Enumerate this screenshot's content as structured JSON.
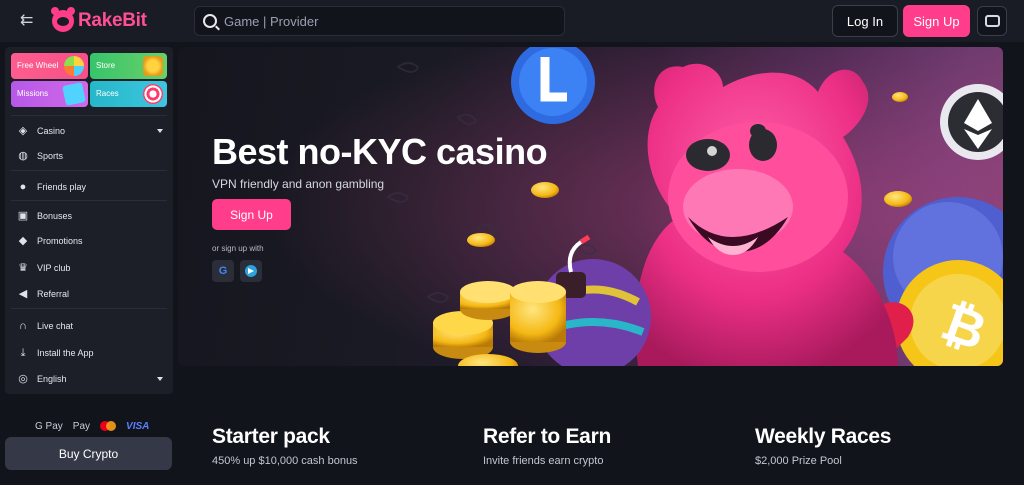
{
  "header": {
    "logo_text": "RakeBit",
    "search_placeholder": "Game | Provider",
    "login_label": "Log In",
    "signup_label": "Sign Up"
  },
  "sidebar": {
    "promos": [
      {
        "label": "Free Wheel"
      },
      {
        "label": "Store"
      },
      {
        "label": "Missions"
      },
      {
        "label": "Races"
      }
    ],
    "items": [
      {
        "label": "Casino",
        "icon": "cube-icon"
      },
      {
        "label": "Sports",
        "icon": "basketball-icon"
      },
      {
        "label": "Friends play",
        "icon": "user-icon"
      },
      {
        "label": "Bonuses",
        "icon": "gift-icon"
      },
      {
        "label": "Promotions",
        "icon": "tag-icon"
      },
      {
        "label": "VIP club",
        "icon": "crown-icon"
      },
      {
        "label": "Referral",
        "icon": "megaphone-icon"
      },
      {
        "label": "Live chat",
        "icon": "headphones-icon"
      },
      {
        "label": "Install the App",
        "icon": "download-icon"
      },
      {
        "label": "English",
        "icon": "globe-icon"
      }
    ]
  },
  "payments": {
    "gpay": "G Pay",
    "applepay": "Pay",
    "visa": "VISA",
    "buy_crypto_label": "Buy Crypto"
  },
  "hero": {
    "title": "Best no-KYC casino",
    "subtitle": "VPN friendly and anon gambling",
    "signup_label": "Sign Up",
    "or_text": "or sign up with",
    "google_glyph": "G"
  },
  "features": [
    {
      "title": "Starter pack",
      "desc": "450% up $10,000 cash bonus"
    },
    {
      "title": "Refer to Earn",
      "desc": "Invite friends earn crypto"
    },
    {
      "title": "Weekly Races",
      "desc": "$2,000 Prize Pool"
    }
  ],
  "colors": {
    "accent": "#ff3d8b",
    "background": "#12141b",
    "panel": "#1c1e28"
  }
}
